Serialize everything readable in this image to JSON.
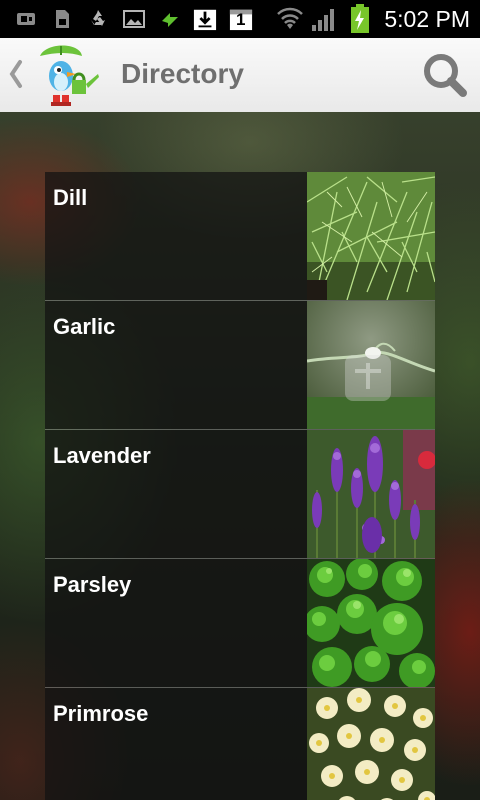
{
  "status_bar": {
    "time": "5:02 PM",
    "notification_count": "1",
    "icons": [
      "usb-icon",
      "sd-card-icon",
      "recycle-icon",
      "picture-icon",
      "sync-arrows-icon",
      "download-icon",
      "calendar-icon",
      "wifi-icon",
      "signal-icon",
      "battery-charging-icon"
    ]
  },
  "action_bar": {
    "title": "Directory",
    "back_icon": "chevron-left-icon",
    "logo_icon": "bird-watering-can-logo",
    "search_icon": "search-icon"
  },
  "colors": {
    "title_text": "#6f6f6f",
    "item_text": "#ffffff",
    "action_bar_bg": "#f2f2f2"
  },
  "directory": {
    "items": [
      {
        "label": "Dill",
        "image": "dill-photo"
      },
      {
        "label": "Garlic",
        "image": "garlic-photo"
      },
      {
        "label": "Lavender",
        "image": "lavender-photo"
      },
      {
        "label": "Parsley",
        "image": "parsley-photo"
      },
      {
        "label": "Primrose",
        "image": "primrose-photo"
      }
    ]
  }
}
